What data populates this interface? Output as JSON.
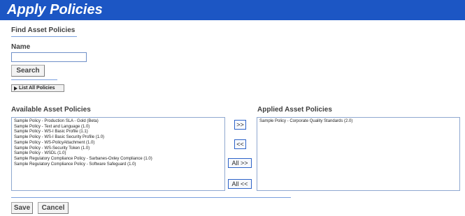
{
  "page": {
    "title": "Apply Policies"
  },
  "find": {
    "heading": "Find Asset Policies",
    "name_label": "Name",
    "name_value": "",
    "search_label": "Search",
    "list_all_label": "List All Policies"
  },
  "available": {
    "heading": "Available Asset Policies",
    "items": [
      "Sample Policy - Production SLA - Gold (Beta)",
      "Sample Policy - Text and Language (1.0)",
      "Sample Policy - WS-I Basic Profile (1.1)",
      "Sample Policy - WS-I Basic Security Profile (1.0)",
      "Sample Policy - WS-PolicyAttachment (1.0)",
      "Sample Policy - WS-Security Token (1.0)",
      "Sample Policy - WSDL (1.0)",
      "Sample Regulatory Compliance Policy - Sarbanes-Oxley Compliance (1.0)",
      "Sample Regulatory Compliance Policy - Software Safeguard (1.0)"
    ]
  },
  "applied": {
    "heading": "Applied Asset Policies",
    "items": [
      "Sample Policy - Corporate Quality Standards (2.0)"
    ]
  },
  "transfer": {
    "add_label": ">>",
    "remove_label": "<<",
    "add_all_label": "All >>",
    "remove_all_label": "All <<"
  },
  "actions": {
    "save_label": "Save",
    "cancel_label": "Cancel"
  },
  "colors": {
    "title_bar": "#1c56c4",
    "accent_line": "#7aa0de",
    "move_button_border": "#2d63c8"
  }
}
